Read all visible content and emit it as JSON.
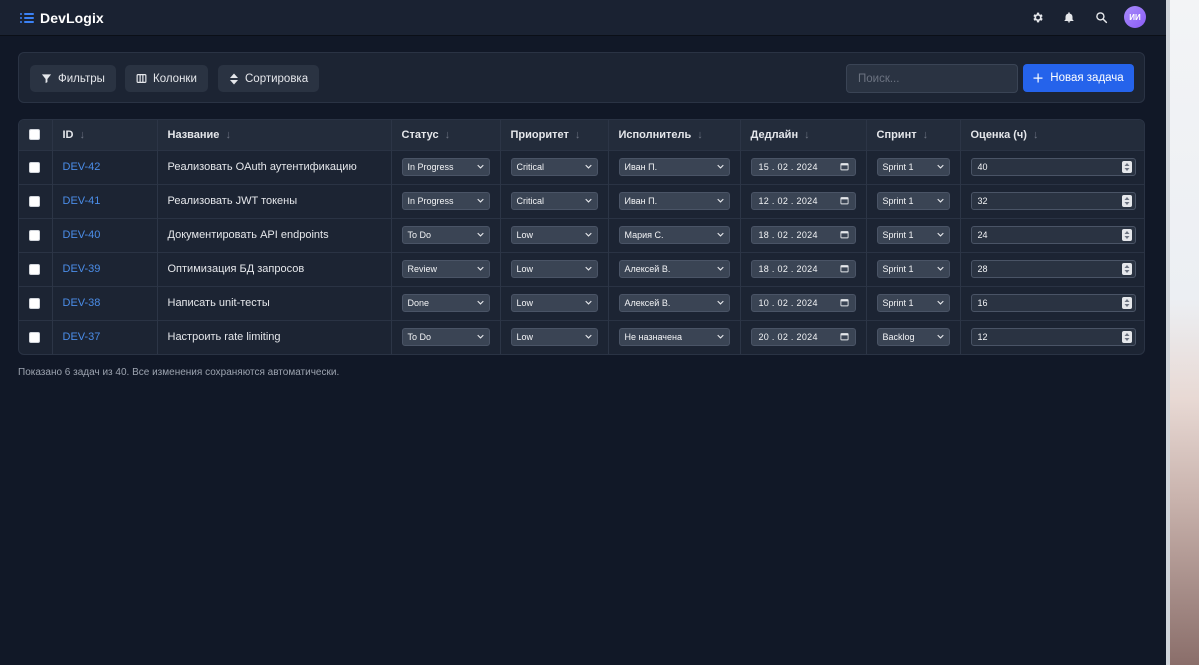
{
  "app": {
    "name": "DevLogix"
  },
  "header": {
    "avatar_initials": "ИИ",
    "icons": [
      "gear-icon",
      "bell-icon",
      "search-icon"
    ]
  },
  "toolbar": {
    "filters_label": "Фильтры",
    "columns_label": "Колонки",
    "sort_label": "Сортировка",
    "search_placeholder": "Поиск...",
    "new_task_label": "Новая задача"
  },
  "table": {
    "columns": [
      "ID",
      "Название",
      "Статус",
      "Приоритет",
      "Исполнитель",
      "Дедлайн",
      "Спринт",
      "Оценка (ч)"
    ],
    "rows": [
      {
        "id": "DEV-42",
        "title": "Реализовать OAuth аутентификацию",
        "status": "In Progress",
        "priority": "Critical",
        "assignee": "Иван П.",
        "deadline": "15 . 02 . 2024",
        "sprint": "Sprint 1",
        "estimate": "40"
      },
      {
        "id": "DEV-41",
        "title": "Реализовать JWT токены",
        "status": "In Progress",
        "priority": "Critical",
        "assignee": "Иван П.",
        "deadline": "12 . 02 . 2024",
        "sprint": "Sprint 1",
        "estimate": "32"
      },
      {
        "id": "DEV-40",
        "title": "Документировать API endpoints",
        "status": "To Do",
        "priority": "Low",
        "assignee": "Мария С.",
        "deadline": "18 . 02 . 2024",
        "sprint": "Sprint 1",
        "estimate": "24"
      },
      {
        "id": "DEV-39",
        "title": "Оптимизация БД запросов",
        "status": "Review",
        "priority": "Low",
        "assignee": "Алексей В.",
        "deadline": "18 . 02 . 2024",
        "sprint": "Sprint 1",
        "estimate": "28"
      },
      {
        "id": "DEV-38",
        "title": "Написать unit-тесты",
        "status": "Done",
        "priority": "Low",
        "assignee": "Алексей В.",
        "deadline": "10 . 02 . 2024",
        "sprint": "Sprint 1",
        "estimate": "16"
      },
      {
        "id": "DEV-37",
        "title": "Настроить rate limiting",
        "status": "To Do",
        "priority": "Low",
        "assignee": "Не назначена",
        "deadline": "20 . 02 . 2024",
        "sprint": "Backlog",
        "estimate": "12"
      }
    ]
  },
  "footer": {
    "note": "Показано 6 задач из 40. Все изменения сохраняются автоматически."
  },
  "colors": {
    "accent": "#2563eb",
    "link": "#4b8de8",
    "background": "#111827",
    "panel": "#1c2433"
  }
}
